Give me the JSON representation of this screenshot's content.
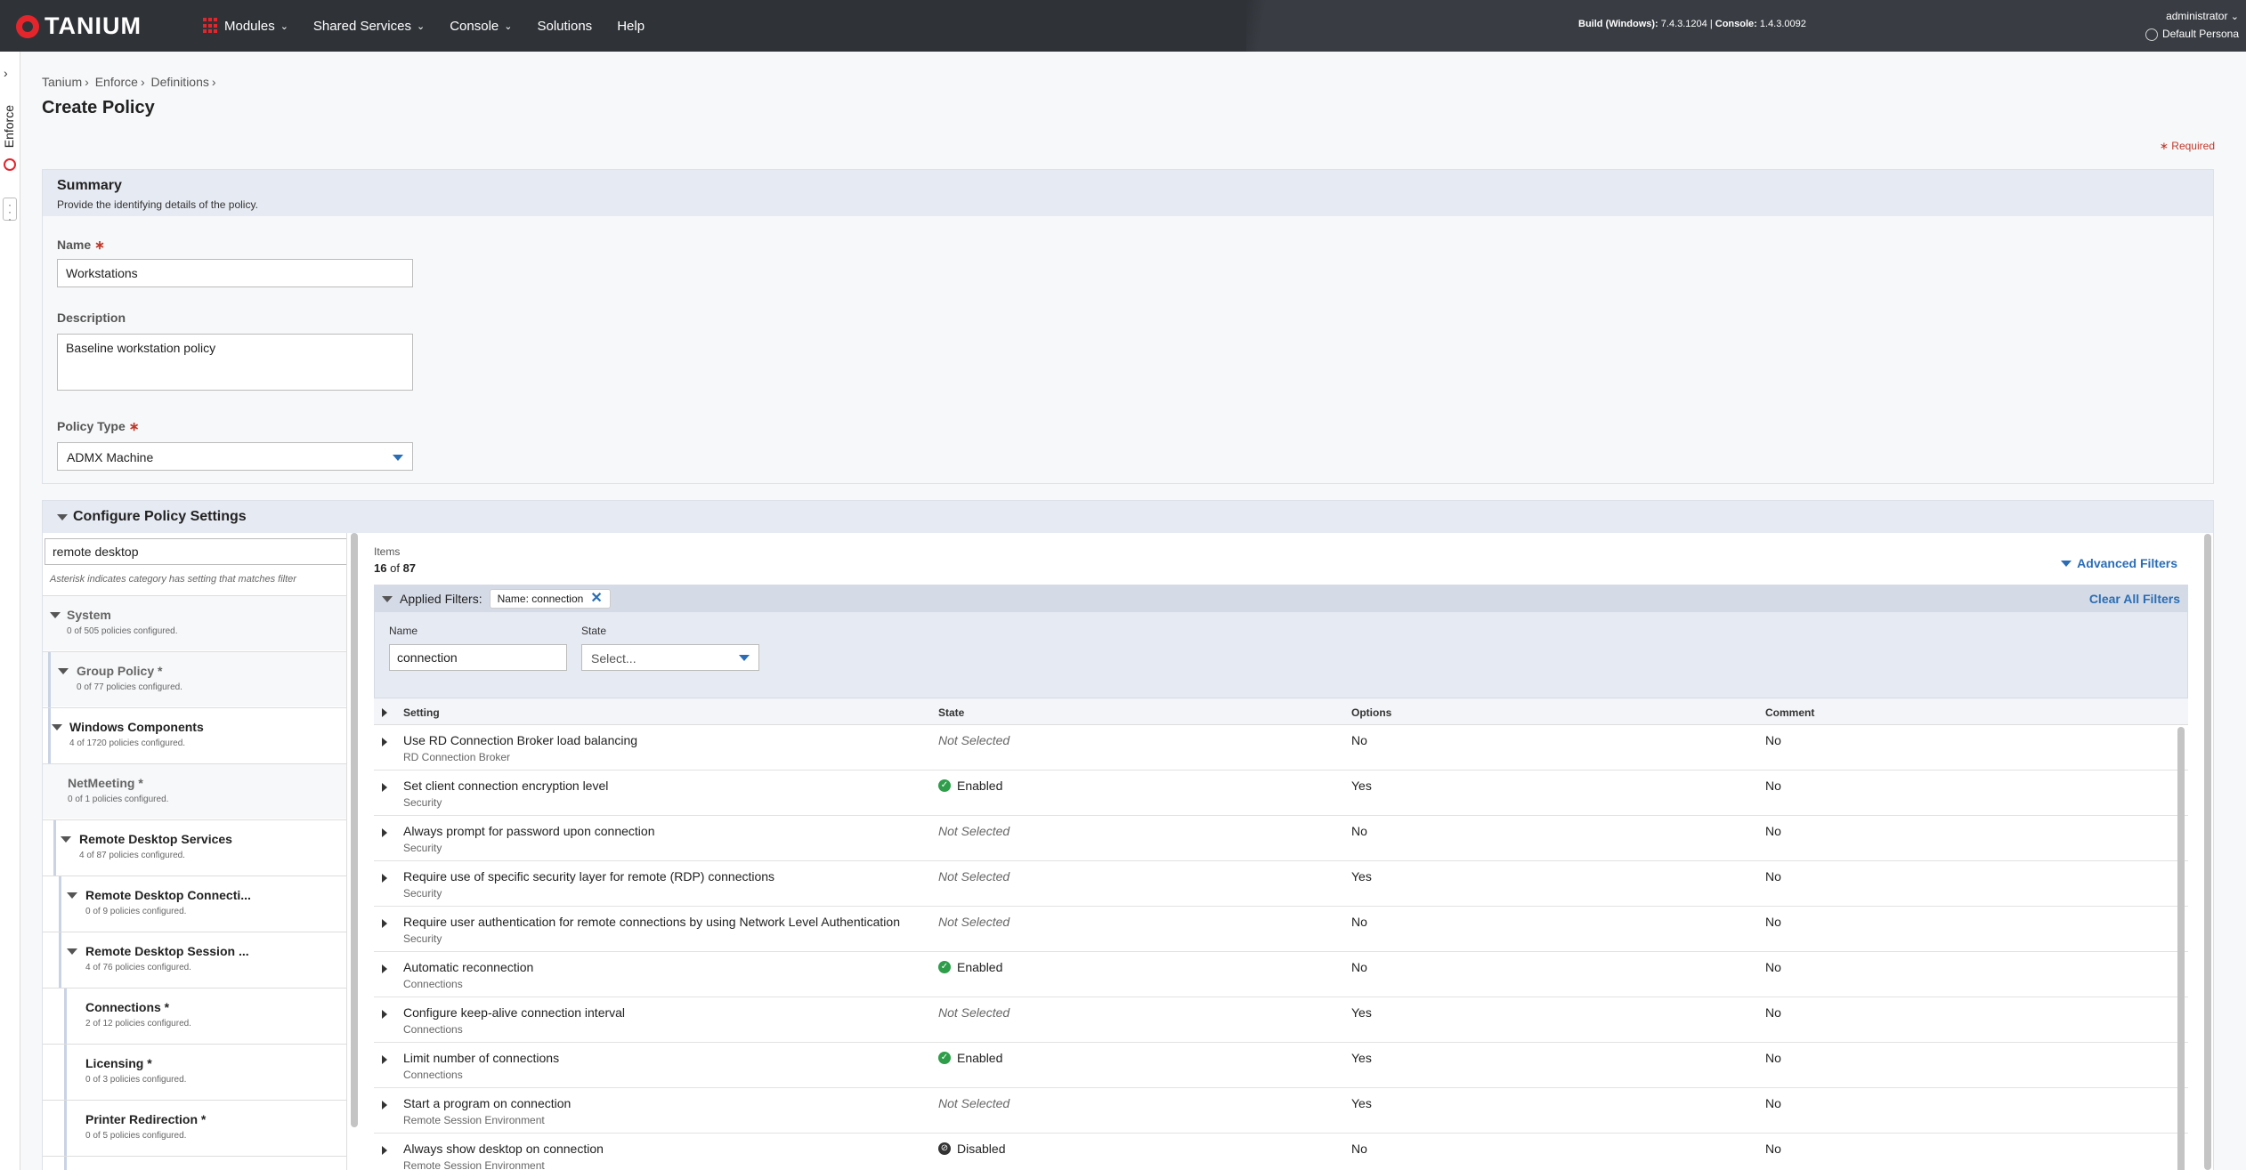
{
  "topbar": {
    "logo": "TANIUM",
    "nav": [
      "Modules",
      "Shared Services",
      "Console",
      "Solutions",
      "Help"
    ],
    "build_label": "Build (Windows):",
    "build_value": "7.4.3.1204",
    "console_label": "Console:",
    "console_value": "1.4.3.0092",
    "user": "administrator",
    "persona": "Default Persona"
  },
  "rail": {
    "module": "Enforce"
  },
  "breadcrumb": [
    "Tanium",
    "Enforce",
    "Definitions"
  ],
  "page_title": "Create Policy",
  "required_note": "Required",
  "summary": {
    "title": "Summary",
    "subtitle": "Provide the identifying details of the policy.",
    "name_label": "Name",
    "name_value": "Workstations",
    "description_label": "Description",
    "description_value": "Baseline workstation policy",
    "policy_type_label": "Policy Type",
    "policy_type_value": "ADMX Machine"
  },
  "configure": {
    "title": "Configure Policy Settings",
    "tree_search": "remote desktop",
    "tree_note": "Asterisk indicates category has setting that matches filter",
    "tree": [
      {
        "name": "System",
        "sub": "0 of 505 policies configured."
      },
      {
        "name": "Group Policy *",
        "sub": "0 of 77 policies configured."
      },
      {
        "name": "Windows Components",
        "sub": "4 of 1720 policies configured."
      },
      {
        "name": "NetMeeting *",
        "sub": "0 of 1 policies configured."
      },
      {
        "name": "Remote Desktop Services",
        "sub": "4 of 87 policies configured."
      },
      {
        "name": "Remote Desktop Connecti...",
        "sub": "0 of 9 policies configured."
      },
      {
        "name": "Remote Desktop Session ...",
        "sub": "4 of 76 policies configured."
      },
      {
        "name": "Connections *",
        "sub": "2 of 12 policies configured."
      },
      {
        "name": "Licensing *",
        "sub": "0 of 3 policies configured."
      },
      {
        "name": "Printer Redirection *",
        "sub": "0 of 5 policies configured."
      }
    ],
    "items_label": "Items",
    "items_shown": "16",
    "items_of": "of",
    "items_total": "87",
    "advanced_filters": "Advanced Filters",
    "applied_filters_label": "Applied Filters:",
    "filter_chip": "Name: connection",
    "clear_all": "Clear All Filters",
    "filter_name_label": "Name",
    "filter_name_value": "connection",
    "filter_state_label": "State",
    "filter_state_value": "Select...",
    "columns": [
      "Setting",
      "State",
      "Options",
      "Comment"
    ],
    "rows": [
      {
        "setting": "Use RD Connection Broker load balancing",
        "category": "RD Connection Broker",
        "state": "Not Selected",
        "options": "No",
        "comment": "No"
      },
      {
        "setting": "Set client connection encryption level",
        "category": "Security",
        "state": "Enabled",
        "options": "Yes",
        "comment": "No"
      },
      {
        "setting": "Always prompt for password upon connection",
        "category": "Security",
        "state": "Not Selected",
        "options": "No",
        "comment": "No"
      },
      {
        "setting": "Require use of specific security layer for remote (RDP) connections",
        "category": "Security",
        "state": "Not Selected",
        "options": "Yes",
        "comment": "No"
      },
      {
        "setting": "Require user authentication for remote connections by using Network Level Authentication",
        "category": "Security",
        "state": "Not Selected",
        "options": "No",
        "comment": "No"
      },
      {
        "setting": "Automatic reconnection",
        "category": "Connections",
        "state": "Enabled",
        "options": "No",
        "comment": "No"
      },
      {
        "setting": "Configure keep-alive connection interval",
        "category": "Connections",
        "state": "Not Selected",
        "options": "Yes",
        "comment": "No"
      },
      {
        "setting": "Limit number of connections",
        "category": "Connections",
        "state": "Enabled",
        "options": "Yes",
        "comment": "No"
      },
      {
        "setting": "Start a program on connection",
        "category": "Remote Session Environment",
        "state": "Not Selected",
        "options": "Yes",
        "comment": "No"
      },
      {
        "setting": "Always show desktop on connection",
        "category": "Remote Session Environment",
        "state": "Disabled",
        "options": "No",
        "comment": "No"
      }
    ]
  }
}
